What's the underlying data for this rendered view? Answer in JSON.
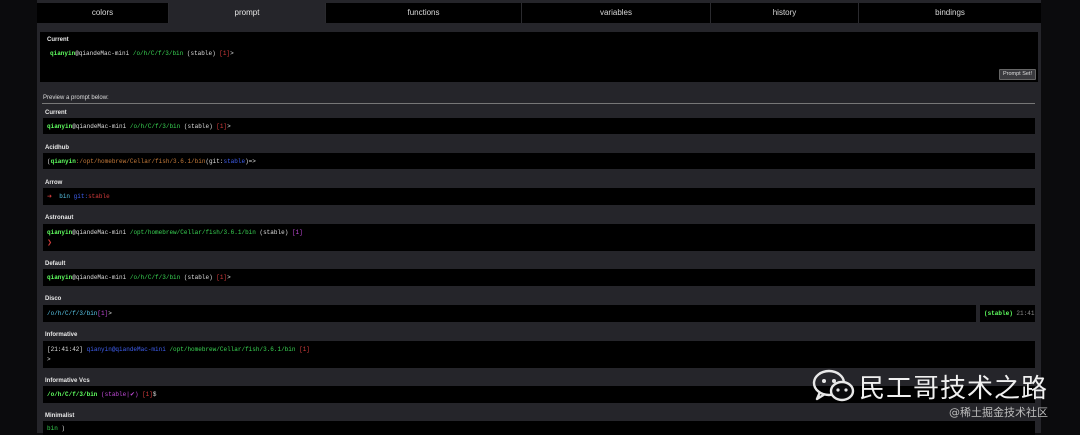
{
  "tabs": [
    "colors",
    "prompt",
    "functions",
    "variables",
    "history",
    "bindings"
  ],
  "current": {
    "title": "Current",
    "user": "qianyin",
    "host": "@qiandeMac-mini",
    "path": "/o/h/C/f/3/bin",
    "branch": "(stable)",
    "status": "[1]",
    "end": ">",
    "button": "Prompt Set!"
  },
  "preview_label": "Preview a prompt below:",
  "prompts": {
    "current": {
      "name": "Current",
      "user": "qianyin",
      "host": "@qiandeMac-mini",
      "path": "/o/h/C/f/3/bin",
      "branch": "(stable)",
      "status": "[1]",
      "end": ">"
    },
    "acidhub": {
      "name": "Acidhub",
      "open": "(",
      "user": "qianyin",
      "path": ":/opt/homebrew/Cellar/fish/3.6.1/bin",
      "git": "(git:",
      "branch": "stable",
      "close": ")",
      "end": ")=>"
    },
    "arrow": {
      "name": "Arrow",
      "arrow": "➜",
      "dir": "bin",
      "git": "git:",
      "branch": "stable"
    },
    "astronaut": {
      "name": "Astronaut",
      "user": "qianyin",
      "host": "@qiandeMac-mini",
      "path": "/opt/homebrew/Cellar/fish/3.6.1/bin",
      "branch": "(stable)",
      "status": "[1]",
      "chev": "❯"
    },
    "default": {
      "name": "Default",
      "user": "qianyin",
      "host": "@qiandeMac-mini",
      "path": "/o/h/C/f/3/bin",
      "branch": "(stable)",
      "status": "[1]",
      "end": ">"
    },
    "disco": {
      "name": "Disco",
      "path": "/o/h/C/f/3/bin",
      "status": "[1]",
      "end": ">",
      "right_branch": "(stable)",
      "time": "21:41"
    },
    "informative": {
      "name": "Informative",
      "time": "[21:41:42]",
      "userhost": "qianyin@qiandeMac-mini",
      "path": "/opt/homebrew/Cellar/fish/3.6.1/bin",
      "status": "[1]",
      "end": ">"
    },
    "informative_vcs": {
      "name": "Informative Vcs",
      "path": "/o/h/C/f/3/bin",
      "branch": "(stable|✔)",
      "status": "[1]",
      "end": "$"
    },
    "minimalist": {
      "name": "Minimalist",
      "dir": "bin",
      "end": ")"
    }
  },
  "watermark": {
    "main": "民工哥技术之路",
    "sub": "@稀土掘金技术社区",
    "icon": "wechat-icon"
  }
}
